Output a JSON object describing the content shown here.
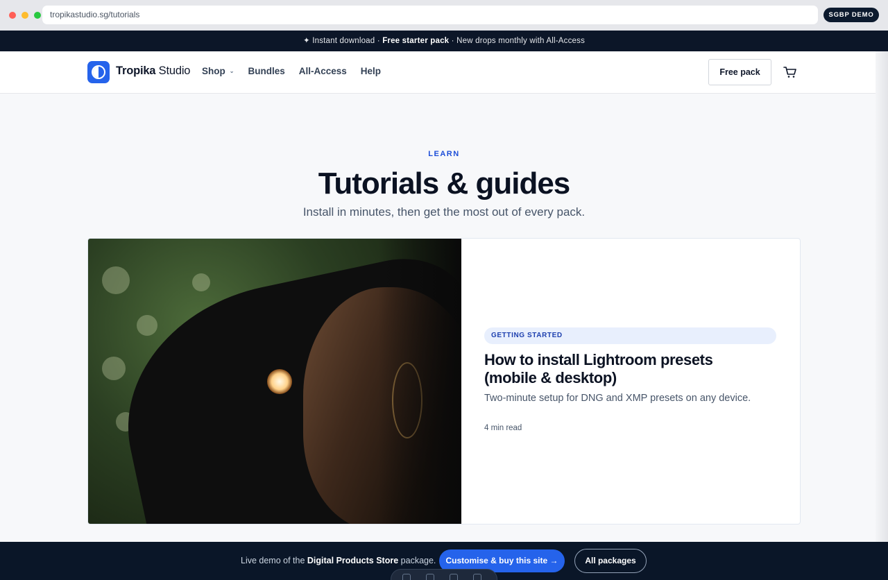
{
  "browser": {
    "url": "tropikastudio.sg/tutorials",
    "badge": "SGBP DEMO"
  },
  "announcement": {
    "part1": "✦ Instant download · ",
    "bold": "Free starter pack",
    "part2": " · New drops monthly with All-Access"
  },
  "header": {
    "brand_bold": "Tropika",
    "brand_rest": " Studio",
    "nav": {
      "shop": "Shop",
      "bundles": "Bundles",
      "all_access": "All-Access",
      "help": "Help"
    },
    "free_pack": "Free pack"
  },
  "hero": {
    "eyebrow": "LEARN",
    "title": "Tutorials & guides",
    "subtitle": "Install in minutes, then get the most out of every pack."
  },
  "featured": {
    "tag": "GETTING STARTED",
    "title": "How to install Lightroom presets (mobile & desktop)",
    "description": "Two-minute setup for DNG and XMP presets on any device.",
    "meta": "4 min read"
  },
  "bottom_bar": {
    "text_before": "Live demo of the ",
    "text_bold": "Digital Products Store",
    "text_after": " package.",
    "buy_label": "Customise & buy this site →",
    "packages_label": "All packages"
  },
  "colors": {
    "accent": "#2563eb",
    "dark": "#0a1628"
  }
}
